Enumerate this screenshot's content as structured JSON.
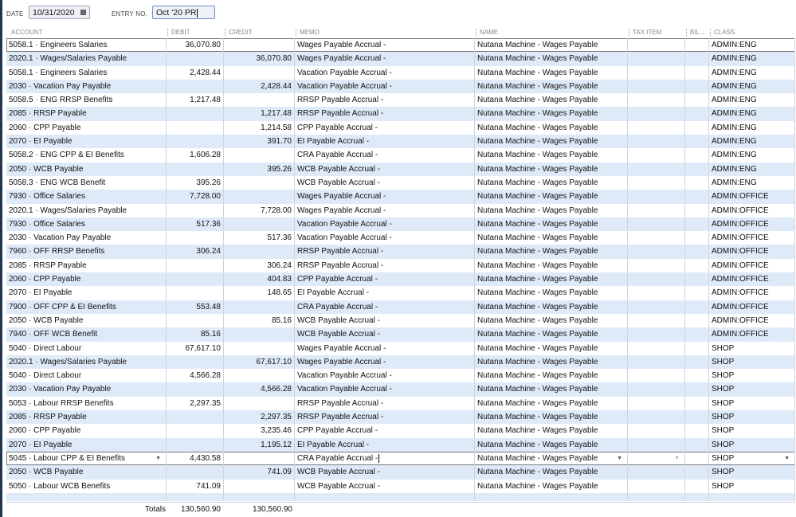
{
  "header": {
    "date_label": "DATE",
    "date_value": "10/31/2020",
    "entry_label": "ENTRY NO.",
    "entry_value": "Oct '20 PR"
  },
  "columns": [
    "ACCOUNT",
    "DEBIT",
    "CREDIT",
    "MEMO",
    "NAME",
    "TAX ITEM",
    "BIL...",
    "CLASS"
  ],
  "rows": [
    [
      "5058.1 · Engineers Salaries",
      "36,070.80",
      "",
      "Wages Payable Accrual -",
      "Nutana Machine - Wages Payable",
      "",
      "",
      "ADMIN:ENG"
    ],
    [
      "2020.1 · Wages/Salaries Payable",
      "",
      "36,070.80",
      "Wages Payable Accrual -",
      "Nutana Machine - Wages Payable",
      "",
      "",
      "ADMIN:ENG"
    ],
    [
      "5058.1 · Engineers Salaries",
      "2,428.44",
      "",
      "Vacation Payable Accrual -",
      "Nutana Machine - Wages Payable",
      "",
      "",
      "ADMIN:ENG"
    ],
    [
      "2030 · Vacation Pay Payable",
      "",
      "2,428.44",
      "Vacation Payable Accrual -",
      "Nutana Machine - Wages Payable",
      "",
      "",
      "ADMIN:ENG"
    ],
    [
      "5058.5 · ENG RRSP Benefits",
      "1,217.48",
      "",
      "RRSP Payable Accrual -",
      "Nutana Machine - Wages Payable",
      "",
      "",
      "ADMIN:ENG"
    ],
    [
      "2085 · RRSP Payable",
      "",
      "1,217.48",
      "RRSP Payable Accrual -",
      "Nutana Machine - Wages Payable",
      "",
      "",
      "ADMIN:ENG"
    ],
    [
      "2060 · CPP Payable",
      "",
      "1,214.58",
      "CPP Payable Accrual -",
      "Nutana Machine - Wages Payable",
      "",
      "",
      "ADMIN:ENG"
    ],
    [
      "2070 · EI Payable",
      "",
      "391.70",
      "EI Payable Accrual -",
      "Nutana Machine - Wages Payable",
      "",
      "",
      "ADMIN:ENG"
    ],
    [
      "5058.2 · ENG CPP & EI Benefits",
      "1,606.28",
      "",
      "CRA Payable Accrual -",
      "Nutana Machine - Wages Payable",
      "",
      "",
      "ADMIN:ENG"
    ],
    [
      "2050 · WCB Payable",
      "",
      "395.26",
      "WCB Payable Accrual -",
      "Nutana Machine - Wages Payable",
      "",
      "",
      "ADMIN:ENG"
    ],
    [
      "5058.3 · ENG WCB Benefit",
      "395.26",
      "",
      "WCB Payable Accrual -",
      "Nutana Machine - Wages Payable",
      "",
      "",
      "ADMIN:ENG"
    ],
    [
      "7930 · Office Salaries",
      "7,728.00",
      "",
      "Wages Payable Accrual -",
      "Nutana Machine - Wages Payable",
      "",
      "",
      "ADMIN:OFFICE"
    ],
    [
      "2020.1 · Wages/Salaries Payable",
      "",
      "7,728.00",
      "Wages Payable Accrual -",
      "Nutana Machine - Wages Payable",
      "",
      "",
      "ADMIN:OFFICE"
    ],
    [
      "7930 · Office Salaries",
      "517.36",
      "",
      "Vacation Payable Accrual -",
      "Nutana Machine - Wages Payable",
      "",
      "",
      "ADMIN:OFFICE"
    ],
    [
      "2030 · Vacation Pay Payable",
      "",
      "517.36",
      "Vacation Payable Accrual -",
      "Nutana Machine - Wages Payable",
      "",
      "",
      "ADMIN:OFFICE"
    ],
    [
      "7960 · OFF RRSP Benefits",
      "306.24",
      "",
      "RRSP Payable Accrual -",
      "Nutana Machine - Wages Payable",
      "",
      "",
      "ADMIN:OFFICE"
    ],
    [
      "2085 · RRSP Payable",
      "",
      "306.24",
      "RRSP Payable Accrual -",
      "Nutana Machine - Wages Payable",
      "",
      "",
      "ADMIN:OFFICE"
    ],
    [
      "2060 · CPP Payable",
      "",
      "404.83",
      "CPP Payable Accrual -",
      "Nutana Machine - Wages Payable",
      "",
      "",
      "ADMIN:OFFICE"
    ],
    [
      "2070 · EI Payable",
      "",
      "148.65",
      "EI Payable Accrual -",
      "Nutana Machine - Wages Payable",
      "",
      "",
      "ADMIN:OFFICE"
    ],
    [
      "7900 · OFF CPP & EI Benefits",
      "553.48",
      "",
      "CRA Payable Accrual -",
      "Nutana Machine - Wages Payable",
      "",
      "",
      "ADMIN:OFFICE"
    ],
    [
      "2050 · WCB Payable",
      "",
      "85.16",
      "WCB Payable Accrual -",
      "Nutana Machine - Wages Payable",
      "",
      "",
      "ADMIN:OFFICE"
    ],
    [
      "7940 · OFF WCB Benefit",
      "85.16",
      "",
      "WCB Payable Accrual -",
      "Nutana Machine - Wages Payable",
      "",
      "",
      "ADMIN:OFFICE"
    ],
    [
      "5040 · Direct Labour",
      "67,617.10",
      "",
      "Wages Payable Accrual -",
      "Nutana Machine - Wages Payable",
      "",
      "",
      "SHOP"
    ],
    [
      "2020.1 · Wages/Salaries Payable",
      "",
      "67,617.10",
      "Wages Payable Accrual -",
      "Nutana Machine - Wages Payable",
      "",
      "",
      "SHOP"
    ],
    [
      "5040 · Direct Labour",
      "4,566.28",
      "",
      "Vacation Payable Accrual -",
      "Nutana Machine - Wages Payable",
      "",
      "",
      "SHOP"
    ],
    [
      "2030 · Vacation Pay Payable",
      "",
      "4,566.28",
      "Vacation Payable Accrual -",
      "Nutana Machine - Wages Payable",
      "",
      "",
      "SHOP"
    ],
    [
      "5053 · Labour RRSP Benefits",
      "2,297.35",
      "",
      "RRSP Payable Accrual -",
      "Nutana Machine - Wages Payable",
      "",
      "",
      "SHOP"
    ],
    [
      "2085 · RRSP Payable",
      "",
      "2,297.35",
      "RRSP Payable Accrual -",
      "Nutana Machine - Wages Payable",
      "",
      "",
      "SHOP"
    ],
    [
      "2060 · CPP Payable",
      "",
      "3,235.46",
      "CPP Payable Accrual -",
      "Nutana Machine - Wages Payable",
      "",
      "",
      "SHOP"
    ],
    [
      "2070 · EI Payable",
      "",
      "1,195.12",
      "EI Payable Accrual -",
      "Nutana Machine - Wages Payable",
      "",
      "",
      "SHOP"
    ],
    [
      "5045 · Labour CPP & EI Benefits",
      "4,430.58",
      "",
      "CRA Payable Accrual -",
      "Nutana Machine - Wages Payable",
      "",
      "",
      "SHOP"
    ],
    [
      "2050 · WCB Payable",
      "",
      "741.09",
      "WCB Payable Accrual -",
      "Nutana Machine - Wages Payable",
      "",
      "",
      "SHOP"
    ],
    [
      "5050 · Labour WCB Benefits",
      "741.09",
      "",
      "WCB Payable Accrual -",
      "Nutana Machine - Wages Payable",
      "",
      "",
      "SHOP"
    ]
  ],
  "editing_row": 30,
  "totals": {
    "label": "Totals",
    "debit": "130,560.90",
    "credit": "130,560.90"
  }
}
